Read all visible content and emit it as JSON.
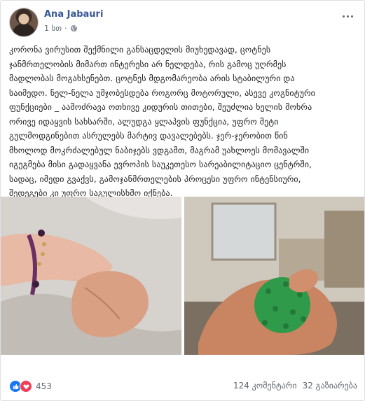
{
  "post": {
    "author": "Ana Jabauri",
    "time": "1 სთ",
    "separator": "·",
    "text_lines": [
      "კორონა ვირუსით შექმნილი განსაცდელის მიუხედავად, ცოტნეს",
      "ჯანმრთელობის მიმართ ინტერესი არ ნელდება, რის გამოც უღრმეს",
      "მადლობას მოგახსენებთ. ცოტნეს მდგომარეობა არის სტაბილური და",
      "საიმედო. ნელ-ნელა უმჯობესდება როგორც მოტორული, ასევე კოგნიტური",
      "ფუნქციები _ აამოძრავა ოთხივე კიდურის თითები, შეუძლია ხელის მოხრა",
      "ორივე იდაყვის სახსარში, ალუდგა ყლაპვის ფუნქცია, უფრო მეტი",
      "გულმოდგინებით ასრულებს მარტივ დავალებებს. ჯერ-ჯერობით წინ",
      "მხოლოდ მოკრძალებულ ნაბიჯებს ვდგამთ, მაგრამ უახლოეს მომავალში",
      "იგეგმება მისი გადაყვანა ევროპის საუკეთესო სარეაბილიტაციო ცენტრში,",
      "სადაც, იმედი გვაქვს, გამოჯანმრთელების პროცესი უფრო ინტენსიური,",
      "შედეგები კი უფრო საგულისხმო იქნება."
    ]
  },
  "footer": {
    "reaction_count": "453",
    "comments": "124 კომენტარი",
    "shares": "32 გაზიარება"
  },
  "icons": {
    "privacy": "globe-icon",
    "more": "more-options-icon",
    "like": "like-icon",
    "love": "love-icon"
  },
  "colors": {
    "author_link": "#385898",
    "like": "#1877f2",
    "love": "#f33e58",
    "meta_text": "#616770"
  }
}
